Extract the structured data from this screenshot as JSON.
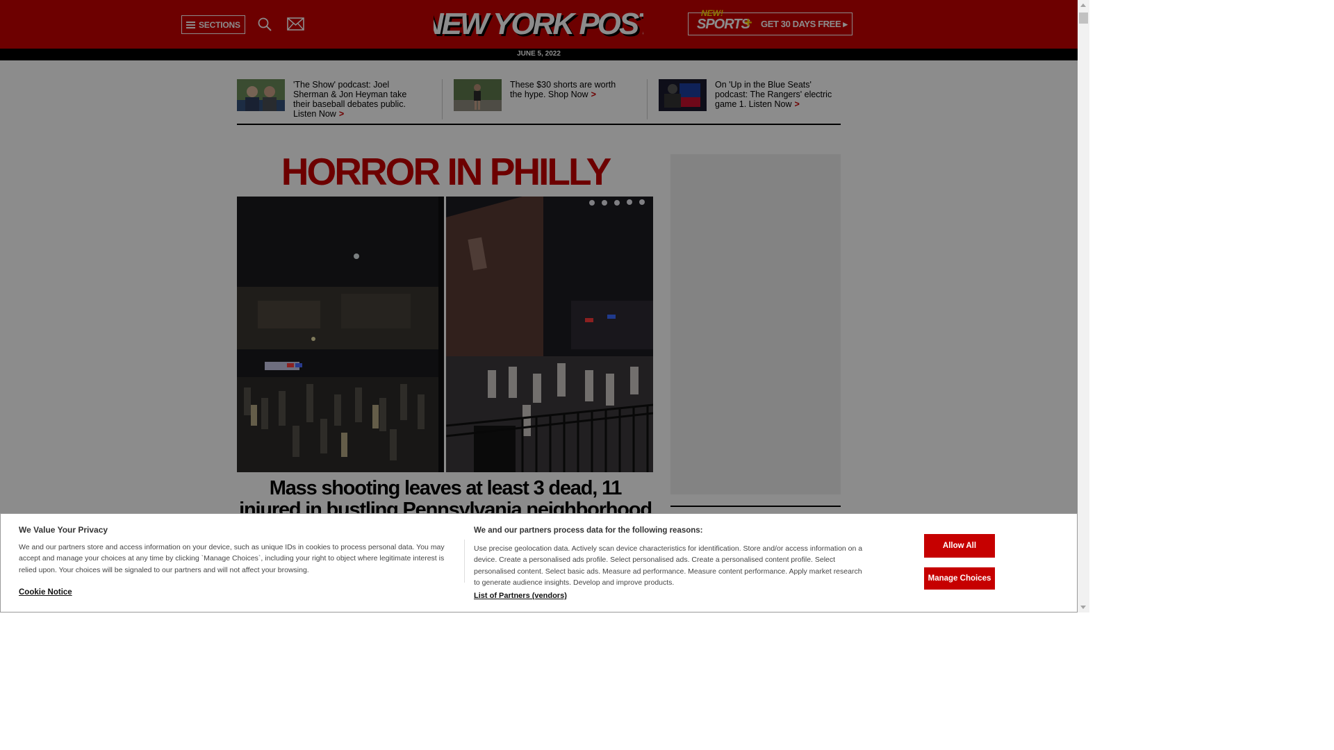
{
  "header": {
    "sections_label": "SECTIONS",
    "logo_text": "NEW YORK POST",
    "promo": {
      "new": "NEW!",
      "sports": "SPORTS",
      "plus": "+",
      "cta": "GET 30 DAYS FREE ▸"
    },
    "date": "JUNE 5, 2022",
    "brand_color": "#c60000"
  },
  "teasers": [
    {
      "text": "'The Show' podcast: Joel Sherman & Jon Heyman take their baseball debates public. Listen Now",
      "chevron": ">"
    },
    {
      "text": "These $30 shorts are worth the hype. Shop Now",
      "chevron": ">"
    },
    {
      "text": "On 'Up in the Blue Seats' podcast: The Rangers' electric game 1. Listen Now",
      "chevron": ">"
    }
  ],
  "main": {
    "kicker": "HORROR IN PHILLY",
    "headline": "Mass shooting leaves at least 3 dead, 11 injured in bustling Pennsylvania neighborhood"
  },
  "cookie": {
    "title": "We Value Your Privacy",
    "body": "We and our partners store and access information on your device, such as unique IDs in cookies to process personal data. You may accept and manage your choices at any time by clicking `Manage Choices`, including your right to object where legitimate interest is relied upon. Your choices will be signaled to our partners and will not affect your browsing.",
    "notice_link": "Cookie Notice",
    "purposes_title": "We and our partners process data for the following reasons:",
    "purposes_body": "Use precise geolocation data. Actively scan device characteristics for identification. Store and/or access information on a device. Create a personalised ads profile. Select personalised ads. Create a personalised content profile. Select personalised content. Select basic ads. Measure ad performance. Measure content performance. Apply market research to generate audience insights. Develop and improve products.",
    "partners_link": "List of Partners (vendors)",
    "allow_all": "Allow All",
    "manage_choices": "Manage Choices"
  }
}
